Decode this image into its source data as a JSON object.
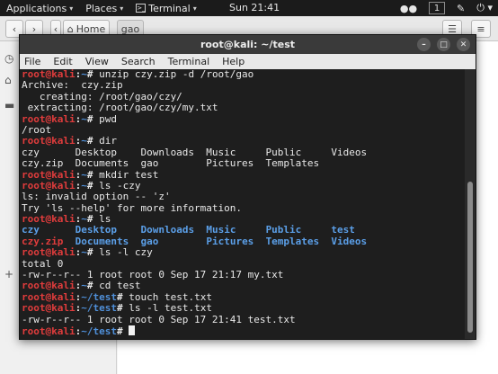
{
  "topbar": {
    "applications": "Applications",
    "places": "Places",
    "terminal": "Terminal",
    "clock": "Sun 21:41",
    "workspace": "1"
  },
  "filemanager": {
    "home_label": "Home",
    "crumb": "gao"
  },
  "terminal": {
    "title": "root@kali: ~/test",
    "menu": [
      "File",
      "Edit",
      "View",
      "Search",
      "Terminal",
      "Help"
    ],
    "lines": [
      {
        "k": "p",
        "path": "~",
        "cmd": "unzip czy.zip -d /root/gao"
      },
      {
        "k": "t",
        "text": "Archive:  czy.zip"
      },
      {
        "k": "t",
        "text": "   creating: /root/gao/czy/"
      },
      {
        "k": "t",
        "text": " extracting: /root/gao/czy/my.txt"
      },
      {
        "k": "p",
        "path": "~",
        "cmd": "pwd"
      },
      {
        "k": "t",
        "text": "/root"
      },
      {
        "k": "p",
        "path": "~",
        "cmd": "dir"
      },
      {
        "k": "t",
        "text": "czy      Desktop    Downloads  Music     Public     Videos"
      },
      {
        "k": "t",
        "text": "czy.zip  Documents  gao        Pictures  Templates"
      },
      {
        "k": "p",
        "path": "~",
        "cmd": "mkdir test"
      },
      {
        "k": "p",
        "path": "~",
        "cmd": "ls -czy"
      },
      {
        "k": "t",
        "text": "ls: invalid option -- 'z'"
      },
      {
        "k": "t",
        "text": "Try 'ls --help' for more information."
      },
      {
        "k": "p",
        "path": "~",
        "cmd": "ls"
      },
      {
        "k": "ls",
        "items": [
          [
            "czy",
            "dir"
          ],
          [
            "Desktop",
            "dir"
          ],
          [
            "Downloads",
            "dir"
          ],
          [
            "Music",
            "dir"
          ],
          [
            "Public",
            "dir"
          ],
          [
            "test",
            "dir"
          ]
        ]
      },
      {
        "k": "ls",
        "items": [
          [
            "czy.zip",
            "zip"
          ],
          [
            "Documents",
            "dir"
          ],
          [
            "gao",
            "dir"
          ],
          [
            "Pictures",
            "dir"
          ],
          [
            "Templates",
            "dir"
          ],
          [
            "Videos",
            "dir"
          ]
        ]
      },
      {
        "k": "p",
        "path": "~",
        "cmd": "ls -l czy"
      },
      {
        "k": "t",
        "text": "total 0"
      },
      {
        "k": "t",
        "text": "-rw-r--r-- 1 root root 0 Sep 17 21:17 my.txt"
      },
      {
        "k": "p",
        "path": "~",
        "cmd": "cd test"
      },
      {
        "k": "p",
        "path": "~/test",
        "cmd": "touch test.txt"
      },
      {
        "k": "p",
        "path": "~/test",
        "cmd": "ls -l test.txt"
      },
      {
        "k": "t",
        "text": "-rw-r--r-- 1 root root 0 Sep 17 21:41 test.txt"
      },
      {
        "k": "p",
        "path": "~/test",
        "cmd": "",
        "cursor": true
      }
    ]
  },
  "prompt": {
    "user": "root@kali",
    "sep": ":",
    "end": "#"
  }
}
